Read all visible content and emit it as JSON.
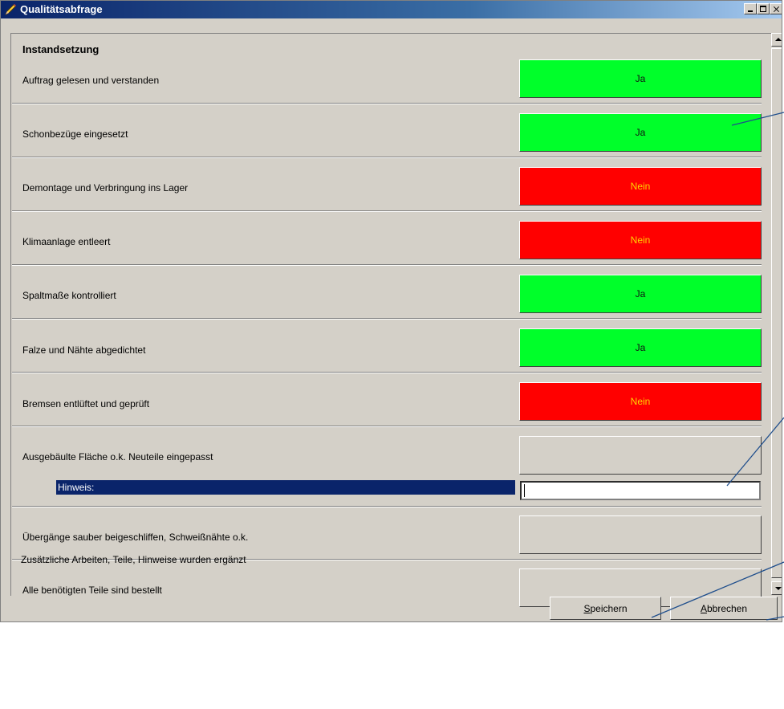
{
  "window": {
    "title": "Qualitätsabfrage"
  },
  "section": {
    "title": "Instandsetzung"
  },
  "rows": [
    {
      "label": "Auftrag gelesen und verstanden",
      "answer": "Ja"
    },
    {
      "label": "Schonbezüge eingesetzt",
      "answer": "Ja"
    },
    {
      "label": "Demontage und Verbringung ins Lager",
      "answer": "Nein"
    },
    {
      "label": "Klimaanlage entleert",
      "answer": "Nein"
    },
    {
      "label": "Spaltmaße kontrolliert",
      "answer": "Ja"
    },
    {
      "label": "Falze und Nähte abgedichtet",
      "answer": "Ja"
    },
    {
      "label": "Bremsen entlüftet und geprüft",
      "answer": "Nein"
    },
    {
      "label": "Ausgebäulte Fläche o.k. Neuteile eingepasst",
      "answer": ""
    },
    {
      "label": "Übergänge sauber beigeschliffen, Schweißnähte o.k.",
      "answer": ""
    },
    {
      "label": "Alle benötigten Teile sind bestellt",
      "answer": ""
    },
    {
      "label": "Zusätzliche Arbeiten, Teile, Hinweise wurden ergänzt",
      "answer": ""
    }
  ],
  "hinweis": {
    "label": "Hinweis:",
    "value": ""
  },
  "buttons": {
    "save": {
      "hotkey": "S",
      "rest": "peichern"
    },
    "cancel": {
      "hotkey": "A",
      "rest": "bbrechen"
    }
  },
  "colors": {
    "ja": "#00ff2a",
    "nein": "#ff0000",
    "nein_text": "#ffd200",
    "title_bar": "#0a246a",
    "annotation_lines": "#1f4e8c"
  }
}
